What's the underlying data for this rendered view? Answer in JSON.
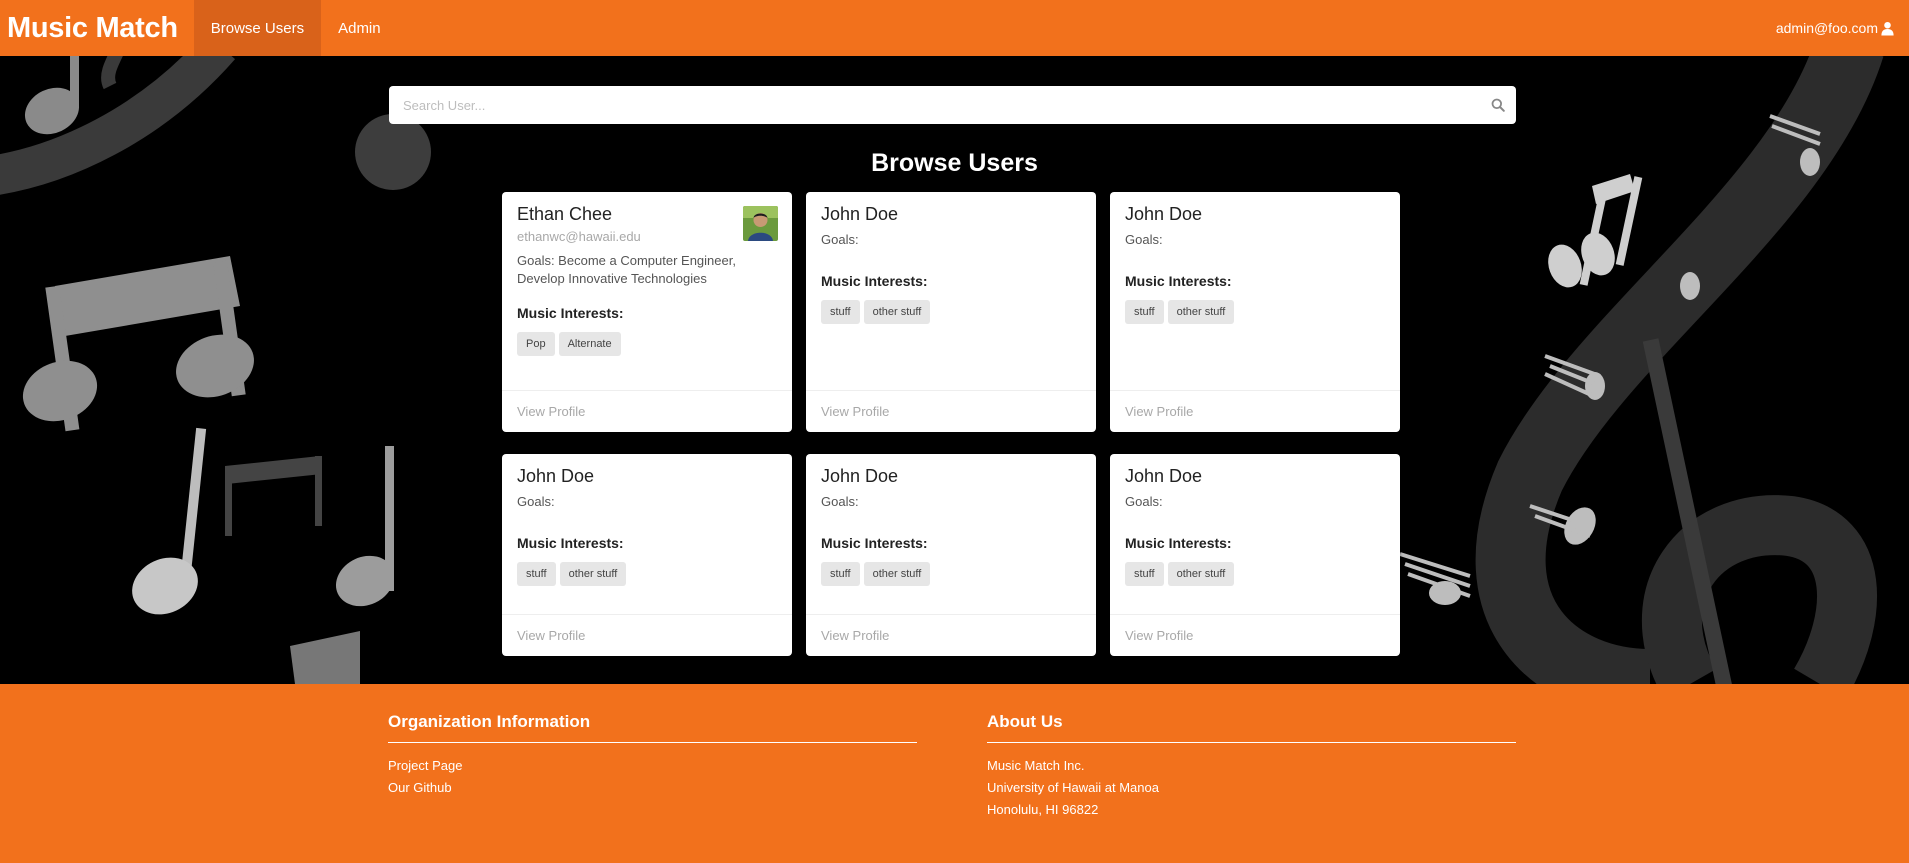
{
  "nav": {
    "brand": "Music Match",
    "items": [
      {
        "label": "Browse Users",
        "active": true
      },
      {
        "label": "Admin",
        "active": false
      }
    ],
    "user": "admin@foo.com",
    "accent": "#f2711c"
  },
  "search": {
    "placeholder": "Search User..."
  },
  "page": {
    "title": "Browse Users"
  },
  "cards": [
    {
      "name": "Ethan Chee",
      "email": "ethanwc@hawaii.edu",
      "goals": "Goals: Become a Computer Engineer, Develop Innovative Technologies",
      "interests_label": "Music Interests:",
      "tags": [
        "Pop",
        "Alternate"
      ],
      "link": "View Profile"
    },
    {
      "name": "John Doe",
      "email": "",
      "goals": "Goals:",
      "interests_label": "Music Interests:",
      "tags": [
        "stuff",
        "other stuff"
      ],
      "link": "View Profile"
    },
    {
      "name": "John Doe",
      "email": "",
      "goals": "Goals:",
      "interests_label": "Music Interests:",
      "tags": [
        "stuff",
        "other stuff"
      ],
      "link": "View Profile"
    },
    {
      "name": "John Doe",
      "email": "",
      "goals": "Goals:",
      "interests_label": "Music Interests:",
      "tags": [
        "stuff",
        "other stuff"
      ],
      "link": "View Profile"
    },
    {
      "name": "John Doe",
      "email": "",
      "goals": "Goals:",
      "interests_label": "Music Interests:",
      "tags": [
        "stuff",
        "other stuff"
      ],
      "link": "View Profile"
    },
    {
      "name": "John Doe",
      "email": "",
      "goals": "Goals:",
      "interests_label": "Music Interests:",
      "tags": [
        "stuff",
        "other stuff"
      ],
      "link": "View Profile"
    }
  ],
  "footer": {
    "org": {
      "title": "Organization Information",
      "links": [
        "Project Page",
        "Our Github"
      ]
    },
    "about": {
      "title": "About Us",
      "lines": [
        "Music Match Inc.",
        "University of Hawaii at Manoa",
        "Honolulu, HI 96822"
      ]
    }
  }
}
